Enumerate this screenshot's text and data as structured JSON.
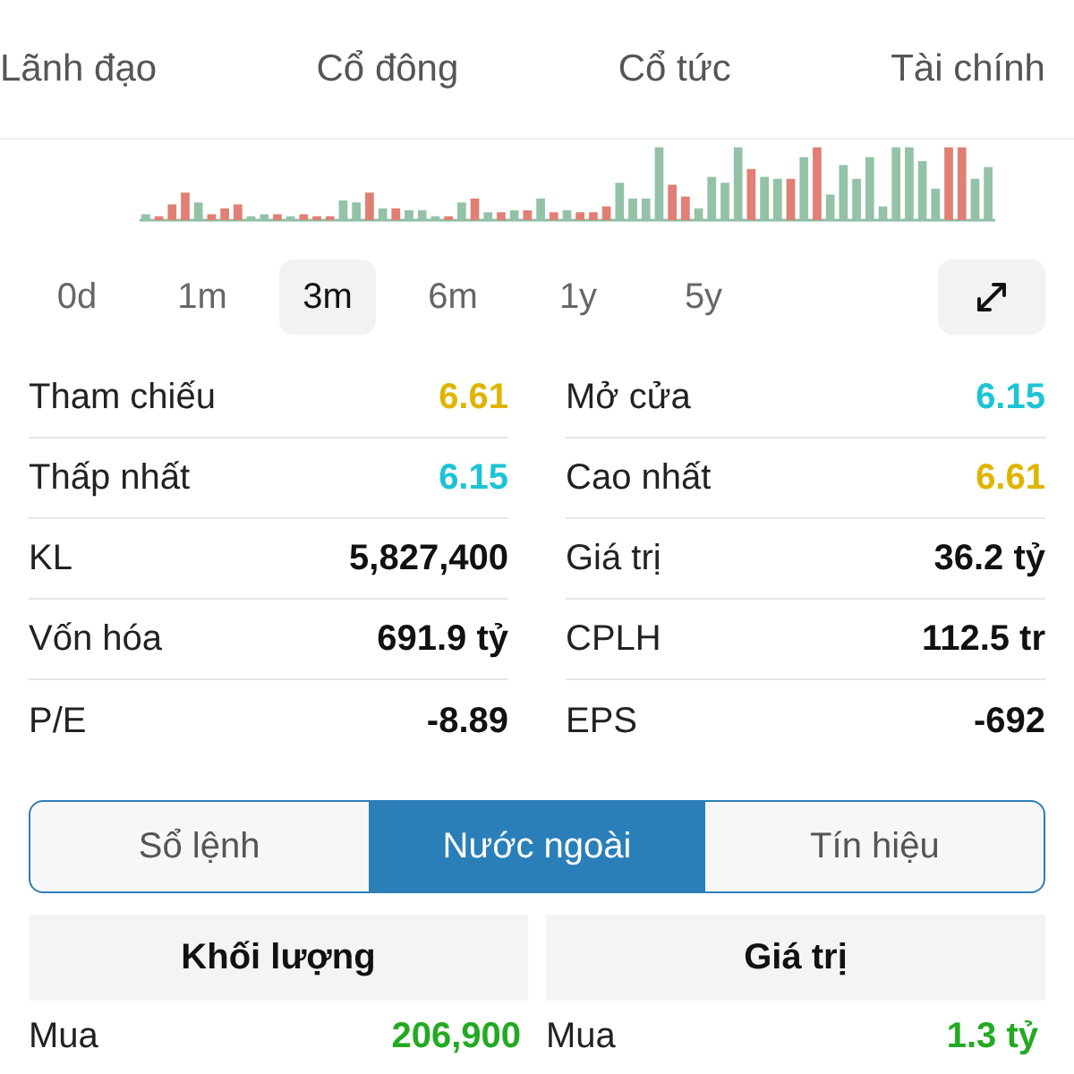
{
  "top_tabs": [
    {
      "label": "Lãnh đạo",
      "selected": false
    },
    {
      "label": "Cổ đông",
      "selected": false
    },
    {
      "label": "Cổ tức",
      "selected": false
    },
    {
      "label": "Tài chính",
      "selected": false
    }
  ],
  "periods": [
    {
      "label": "0d",
      "selected": false
    },
    {
      "label": "1m",
      "selected": false
    },
    {
      "label": "3m",
      "selected": true
    },
    {
      "label": "6m",
      "selected": false
    },
    {
      "label": "1y",
      "selected": false
    },
    {
      "label": "5y",
      "selected": false
    }
  ],
  "stats": [
    [
      {
        "label": "Tham chiếu",
        "value": "6.61",
        "color": "#e0b400"
      },
      {
        "label": "Mở cửa",
        "value": "6.15",
        "color": "#1cc4d6"
      }
    ],
    [
      {
        "label": "Thấp nhất",
        "value": "6.15",
        "color": "#1cc4d6"
      },
      {
        "label": "Cao nhất",
        "value": "6.61",
        "color": "#e0b400"
      }
    ],
    [
      {
        "label": "KL",
        "value": "5,827,400",
        "color": "#111111"
      },
      {
        "label": "Giá trị",
        "value": "36.2 tỷ",
        "color": "#111111"
      }
    ],
    [
      {
        "label": "Vốn hóa",
        "value": "691.9 tỷ",
        "color": "#111111"
      },
      {
        "label": "CPLH",
        "value": "112.5 tr",
        "color": "#111111"
      }
    ],
    [
      {
        "label": "P/E",
        "value": "-8.89",
        "color": "#111111"
      },
      {
        "label": "EPS",
        "value": "-692",
        "color": "#111111"
      }
    ]
  ],
  "segments": [
    {
      "label": "Sổ lệnh",
      "selected": false
    },
    {
      "label": "Nước ngoài",
      "selected": true
    },
    {
      "label": "Tín hiệu",
      "selected": false
    }
  ],
  "foreign": [
    {
      "header": "Khối lượng",
      "rows": [
        {
          "label": "Mua",
          "value": "206,900"
        }
      ]
    },
    {
      "header": "Giá trị",
      "rows": [
        {
          "label": "Mua",
          "value": "1.3 tỷ"
        }
      ]
    }
  ]
}
